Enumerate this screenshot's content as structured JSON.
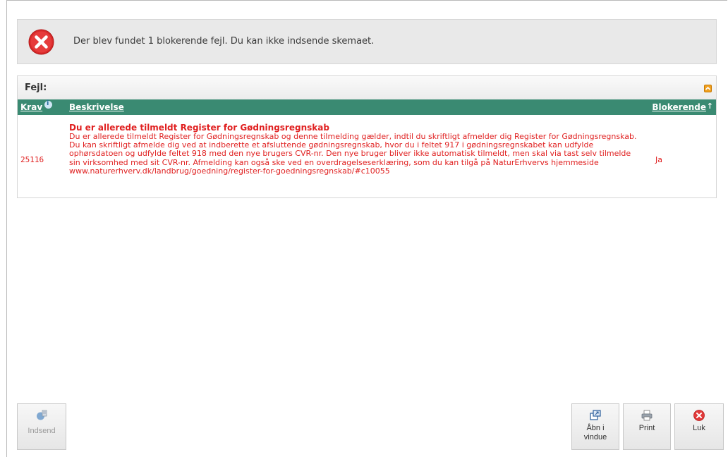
{
  "alert": {
    "icon": "error-icon",
    "message": "Der blev fundet 1 blokerende fejl. Du kan ikke indsende skemaet."
  },
  "errors_panel": {
    "title": "Fejl:",
    "columns": {
      "krav": "Krav",
      "beskrivelse": "Beskrivelse",
      "blokerende": "Blokerende"
    },
    "sort_indicator": "↑",
    "rows": [
      {
        "krav": "25116",
        "title": "Du er allerede tilmeldt Register for Gødningsregnskab",
        "description": "Du er allerede tilmeldt Register for Gødningsregnskab og denne tilmelding gælder, indtil du skriftligt afmelder dig Register for Gødningsregnskab. Du kan skriftligt afmelde dig ved at indberette et afsluttende gødningsregnskab, hvor du i feltet 917 i gødningsregnskabet kan udfylde ophørsdatoen og udfylde feltet 918 med den nye brugers CVR-nr. Den nye bruger bliver ikke automatisk tilmeldt, men skal via tast selv tilmelde sin virksomhed med sit CVR-nr. Afmelding kan også ske ved en overdragelseserklæring, som du kan tilgå på NaturErhvervs hjemmeside www.naturerhverv.dk/landbrug/goedning/register-for-goedningsregnskab/#c10055",
        "blokerende": "Ja"
      }
    ]
  },
  "buttons": {
    "indsend": "Indsend",
    "abn_line1": "Åbn i",
    "abn_line2": "vindue",
    "print": "Print",
    "luk": "Luk"
  },
  "colors": {
    "error_red": "#e02020",
    "header_green": "#3a8a72"
  }
}
